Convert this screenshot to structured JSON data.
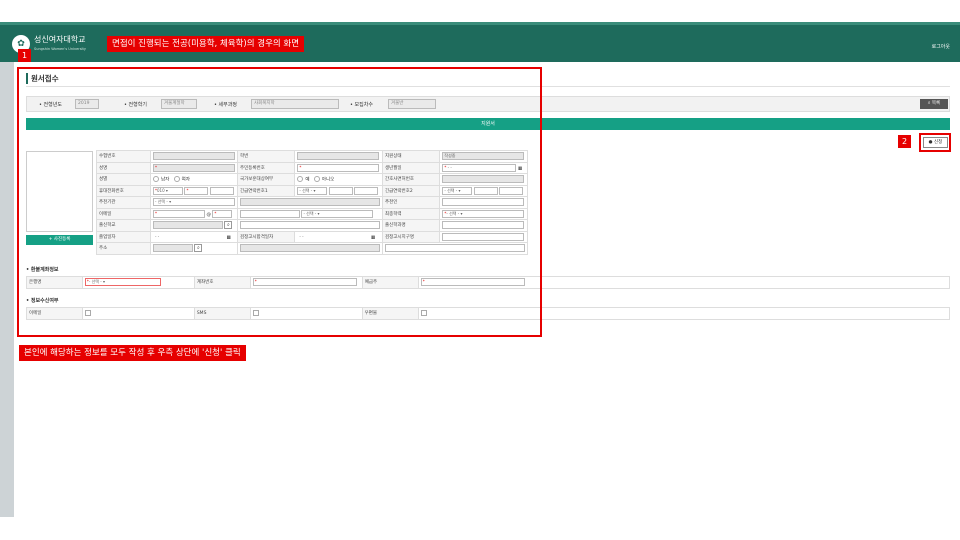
{
  "header": {
    "school_name": "성신여자대학교",
    "school_sub": "Sungshin Women's University",
    "logout": "로그아웃"
  },
  "annotations": {
    "title_label": "면접이 진행되는 전공(미용학, 체육학)의 경우의 화면",
    "step1": "1",
    "step2": "2",
    "bottom_label": "본인에 해당하는 정보를 모두 작성 후 우측 상단에 '신청' 클릭"
  },
  "page": {
    "title": "원서접수"
  },
  "filter": {
    "year_label": "• 전형년도",
    "year_value": "2019",
    "term_label": "• 전형학기",
    "term_value": "겨울계절학",
    "course_label": "• 세부과정",
    "course_value": "사회복지학",
    "round_label": "• 모집차수",
    "round_value": "겨울반",
    "list_button": "목록"
  },
  "section": {
    "title": "지원서"
  },
  "apply_button": "신청",
  "photo_button": "+ 사진등록",
  "form": {
    "exam_no": "수험번호",
    "student_no": "학번",
    "apply_status": "지원상태",
    "apply_status_value": "작성중",
    "name": "성명",
    "resident_no": "주민등록번호",
    "birth": "생년월일",
    "birth_value": "-  -",
    "gender": "성별",
    "male": "남자",
    "female": "여자",
    "veteran": "국가보훈대상여부",
    "yes": "예",
    "no": "아니오",
    "nurse_license": "간호사면허번호",
    "mobile": "휴대전화번호",
    "mobile_prefix": "010",
    "emergency1": "긴급연락번호1",
    "emergency2": "긴급연락번호2",
    "select": "- 선택 -",
    "recommender_org": "추천기관",
    "recommender": "추천인",
    "email": "이메일",
    "at": "@",
    "final_degree": "최종학력",
    "school": "출신학교",
    "major": "출신학과명",
    "grad_date": "졸업일자",
    "date_value": "-  -",
    "ged_date": "검정고시합격일자",
    "ged_region": "검정고시지구명",
    "address": "주소"
  },
  "refund": {
    "title": "• 환불계좌정보",
    "bank": "은행명",
    "account": "계좌번호",
    "holder": "예금주"
  },
  "consent": {
    "title": "• 정보수신여부",
    "email": "이메일",
    "sms": "SMS",
    "mail": "우편물"
  }
}
